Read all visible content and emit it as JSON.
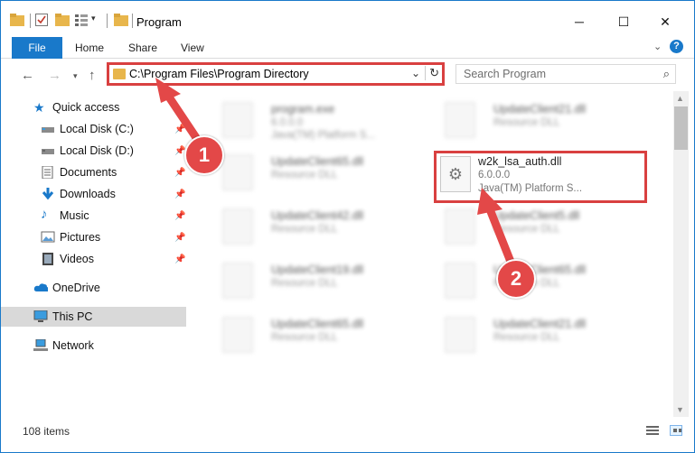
{
  "window": {
    "title": "Program",
    "controls": {
      "minimize": "─",
      "maximize": "☐",
      "close": "✕"
    }
  },
  "ribbon": {
    "tabs": [
      "File",
      "Home",
      "Share",
      "View"
    ],
    "expand_icon": "chevron-down-icon",
    "help_icon": "?"
  },
  "address_bar": {
    "path": "C:\\Program Files\\Program Directory",
    "search_placeholder": "Search Program"
  },
  "sidebar": {
    "quick_access": "Quick access",
    "items": [
      {
        "label": "Local Disk (C:)",
        "icon": "drive-icon"
      },
      {
        "label": "Local Disk (D:)",
        "icon": "drive-icon"
      },
      {
        "label": "Documents",
        "icon": "documents-icon"
      },
      {
        "label": "Downloads",
        "icon": "downloads-icon"
      },
      {
        "label": "Music",
        "icon": "music-icon"
      },
      {
        "label": "Pictures",
        "icon": "pictures-icon"
      },
      {
        "label": "Videos",
        "icon": "videos-icon"
      }
    ],
    "onedrive": "OneDrive",
    "this_pc": "This PC",
    "network": "Network"
  },
  "files": [
    {
      "name": "program.exe",
      "line2": "6.0.0.0",
      "line3": "Java(TM) Platform S..."
    },
    {
      "name": "UpdateClient21.dll",
      "line2": "Resource DLL",
      "line3": ""
    },
    {
      "name": "UpdateClient65.dll",
      "line2": "Resource DLL",
      "line3": ""
    },
    {
      "name": "w2k_lsa_auth.dll",
      "line2": "6.0.0.0",
      "line3": "Java(TM) Platform S..."
    },
    {
      "name": "UpdateClient42.dll",
      "line2": "Resource DLL",
      "line3": ""
    },
    {
      "name": "UpdateClient5.dll",
      "line2": "Resource DLL",
      "line3": ""
    },
    {
      "name": "UpdateClient19.dll",
      "line2": "Resource DLL",
      "line3": ""
    },
    {
      "name": "UpdateClient65.dll",
      "line2": "Resource DLL",
      "line3": ""
    },
    {
      "name": "UpdateClient65.dll",
      "line2": "Resource DLL",
      "line3": ""
    },
    {
      "name": "UpdateClient21.dll",
      "line2": "Resource DLL",
      "line3": ""
    }
  ],
  "status": {
    "item_count": "108 items"
  },
  "annotations": {
    "step1": "1",
    "step2": "2"
  },
  "colors": {
    "accent": "#1979ca",
    "highlight": "#d94040",
    "folder": "#e8b64c"
  }
}
